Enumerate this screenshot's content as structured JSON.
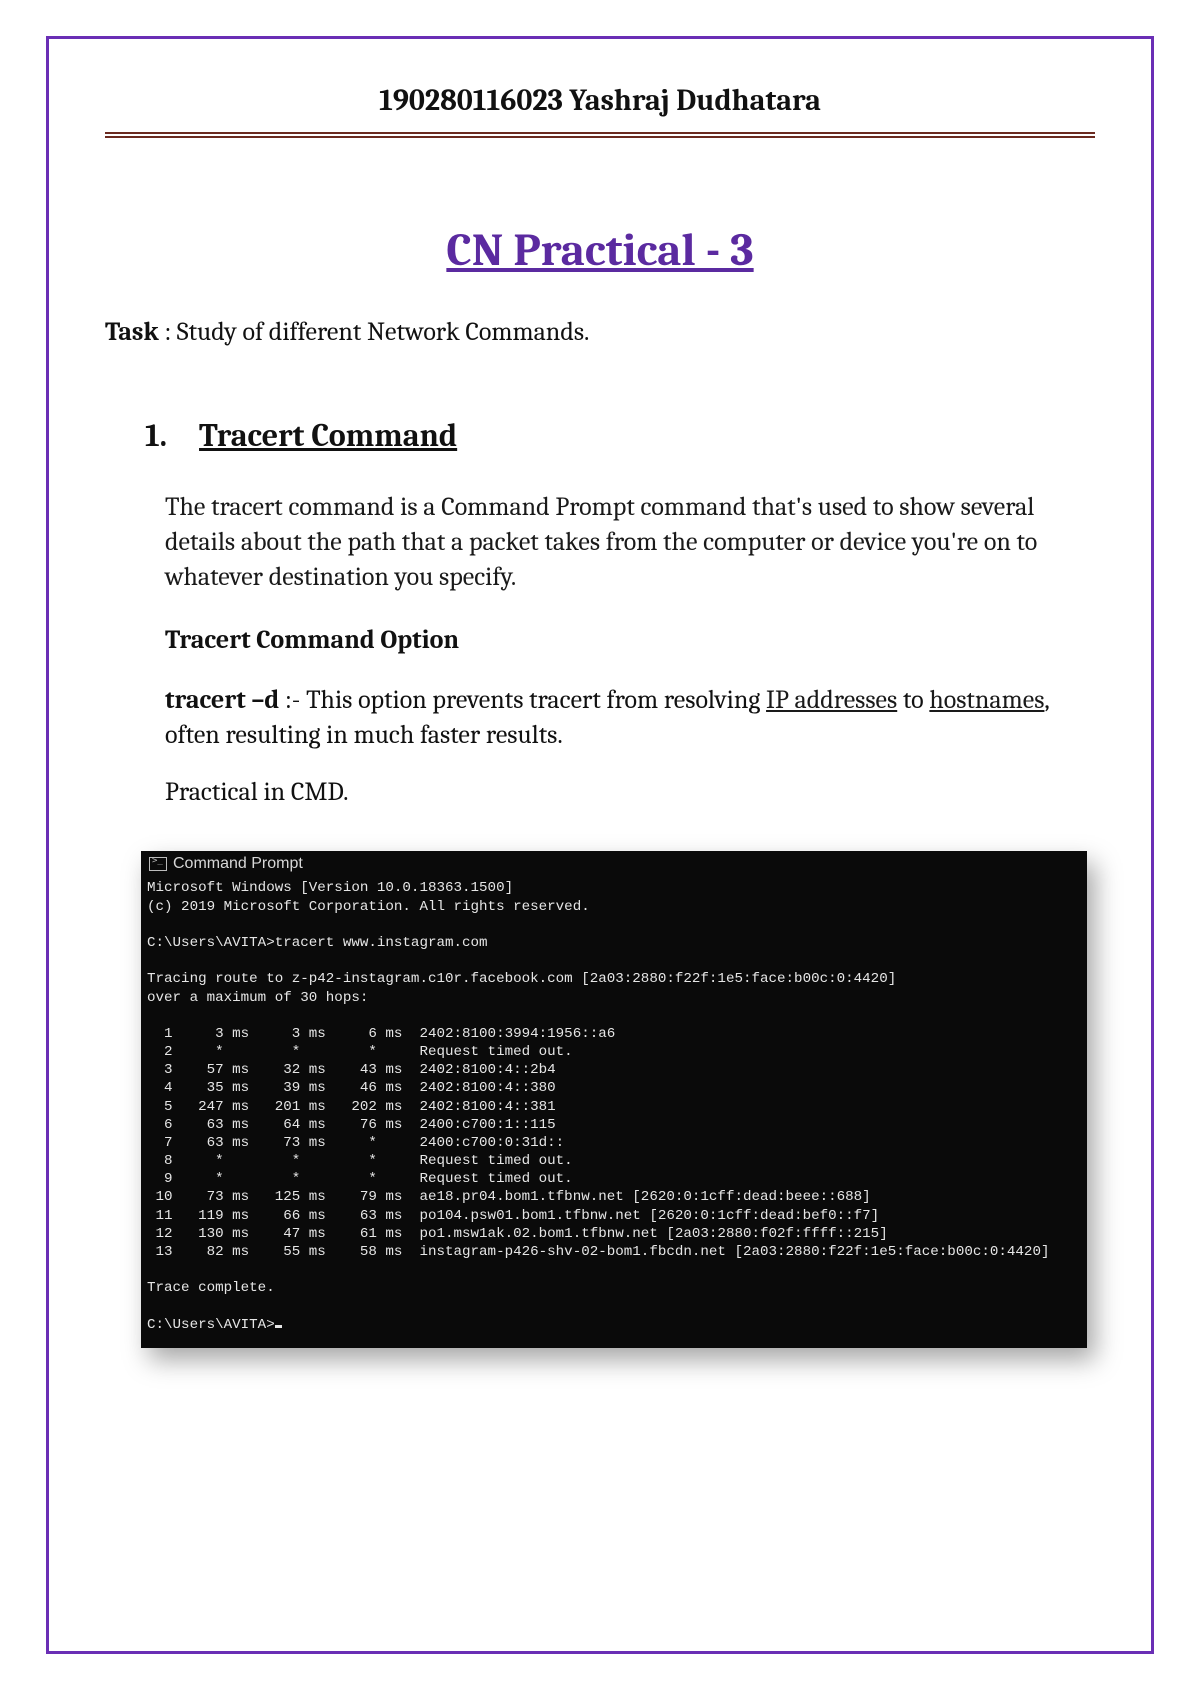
{
  "header": "190280116023 Yashraj Dudhatara",
  "title": "CN Practical - 3",
  "task_label": "Task",
  "task_text": " : Study of different Network Commands.",
  "section_number": "1.",
  "section_title": "Tracert Command",
  "tracert_para": "The tracert command is a Command Prompt command that's used to show several details about the path that a packet takes from the computer or device you're on to whatever destination you specify.",
  "option_heading": "Tracert Command Option",
  "opt_cmd": "tracert –d",
  "opt_pre": " :- This option prevents tracert from resolving ",
  "opt_link1": "IP addresses",
  "opt_mid": " to ",
  "opt_link2": "hostnames",
  "opt_post": ", often resulting in much faster results.",
  "practical_label": "Practical in CMD.",
  "term_title": "Command Prompt",
  "term_lines": [
    "Microsoft Windows [Version 10.0.18363.1500]",
    "(c) 2019 Microsoft Corporation. All rights reserved.",
    "",
    "C:\\Users\\AVITA>tracert www.instagram.com",
    "",
    "Tracing route to z-p42-instagram.c10r.facebook.com [2a03:2880:f22f:1e5:face:b00c:0:4420]",
    "over a maximum of 30 hops:",
    "",
    "  1     3 ms     3 ms     6 ms  2402:8100:3994:1956::a6",
    "  2     *        *        *     Request timed out.",
    "  3    57 ms    32 ms    43 ms  2402:8100:4::2b4",
    "  4    35 ms    39 ms    46 ms  2402:8100:4::380",
    "  5   247 ms   201 ms   202 ms  2402:8100:4::381",
    "  6    63 ms    64 ms    76 ms  2400:c700:1::115",
    "  7    63 ms    73 ms     *     2400:c700:0:31d::",
    "  8     *        *        *     Request timed out.",
    "  9     *        *        *     Request timed out.",
    " 10    73 ms   125 ms    79 ms  ae18.pr04.bom1.tfbnw.net [2620:0:1cff:dead:beee::688]",
    " 11   119 ms    66 ms    63 ms  po104.psw01.bom1.tfbnw.net [2620:0:1cff:dead:bef0::f7]",
    " 12   130 ms    47 ms    61 ms  po1.msw1ak.02.bom1.tfbnw.net [2a03:2880:f02f:ffff::215]",
    " 13    82 ms    55 ms    58 ms  instagram-p426-shv-02-bom1.fbcdn.net [2a03:2880:f22f:1e5:face:b00c:0:4420]",
    "",
    "Trace complete.",
    "",
    "C:\\Users\\AVITA>"
  ]
}
